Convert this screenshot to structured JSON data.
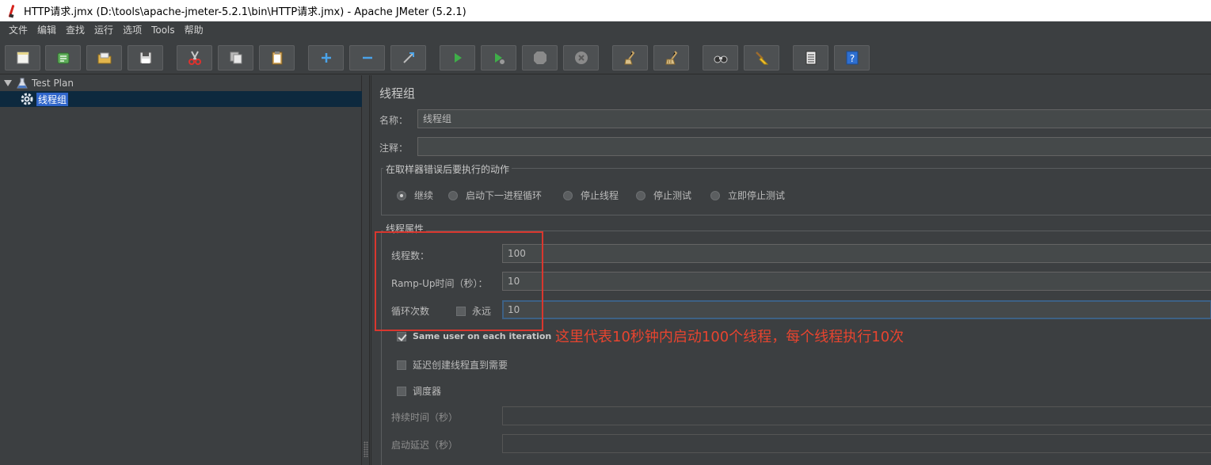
{
  "window": {
    "title": "HTTP请求.jmx (D:\\tools\\apache-jmeter-5.2.1\\bin\\HTTP请求.jmx) - Apache JMeter (5.2.1)"
  },
  "menu": [
    "文件",
    "编辑",
    "查找",
    "运行",
    "选项",
    "Tools",
    "帮助"
  ],
  "toolbar": {
    "buttons": [
      "new-icon",
      "templates-icon",
      "open-icon",
      "save-icon",
      "cut-icon",
      "copy-icon",
      "paste-icon",
      "expand-icon",
      "collapse-icon",
      "toggle-icon",
      "start-icon",
      "start-no-pause-icon",
      "stop-icon",
      "shutdown-icon",
      "clear-icon",
      "clear-all-icon",
      "search-icon",
      "reset-search-icon",
      "function-helper-icon",
      "help-icon"
    ]
  },
  "tree": {
    "root": "Test Plan",
    "selected": "线程组"
  },
  "thread_group": {
    "title": "线程组",
    "name_label": "名称：",
    "name_value": "线程组",
    "comment_label": "注释：",
    "comment_value": "",
    "on_error": {
      "legend": "在取样器错误后要执行的动作",
      "options": [
        "继续",
        "启动下一进程循环",
        "停止线程",
        "停止测试",
        "立即停止测试"
      ],
      "selected": "继续"
    },
    "properties": {
      "legend": "线程属性",
      "threads_label": "线程数：",
      "threads_value": "100",
      "rampup_label": "Ramp-Up时间（秒）：",
      "rampup_value": "10",
      "loop_label": "循环次数",
      "forever_label": "永远",
      "forever_checked": false,
      "loop_value": "10",
      "same_user_label": "Same user on each iteration",
      "same_user_checked": true,
      "delay_label": "延迟创建线程直到需要",
      "delay_checked": false,
      "scheduler_label": "调度器",
      "scheduler_checked": false,
      "duration_label": "持续时间（秒）",
      "duration_value": "",
      "startup_delay_label": "启动延迟（秒）",
      "startup_delay_value": ""
    }
  },
  "annotation": "这里代表10秒钟内启动100个线程，每个线程执行10次",
  "colors": {
    "background": "#3c3f41",
    "annotation": "#e8442f",
    "selection": "#2f65ca"
  }
}
